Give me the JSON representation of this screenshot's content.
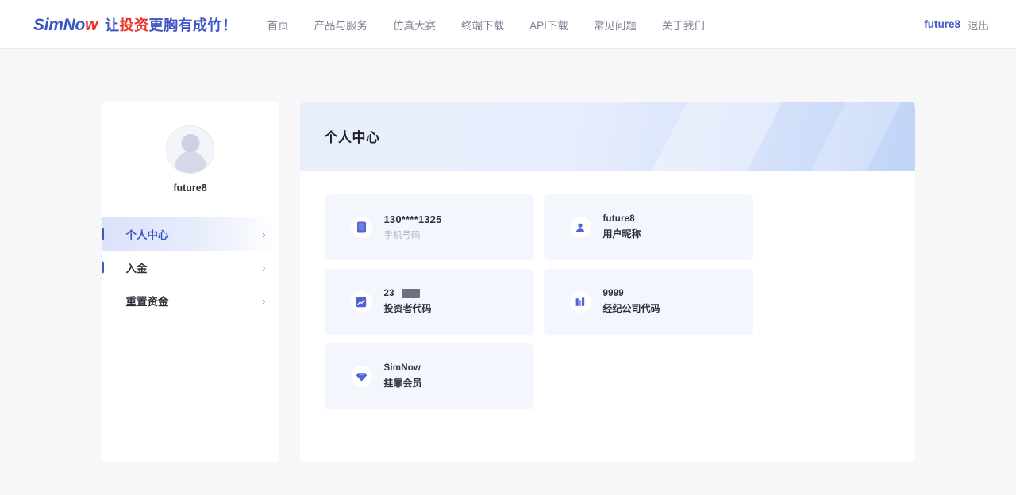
{
  "topbar": {
    "logo": {
      "part1": "SimNo",
      "part2": "w"
    },
    "slogan": {
      "p1": "让",
      "p2": "投资",
      "p3": "更胸有成竹！"
    },
    "nav": [
      {
        "label": "首页",
        "name": "nav-home"
      },
      {
        "label": "产品与服务",
        "name": "nav-products"
      },
      {
        "label": "仿真大赛",
        "name": "nav-contest"
      },
      {
        "label": "终端下载",
        "name": "nav-terminal-download"
      },
      {
        "label": "API下载",
        "name": "nav-api-download"
      },
      {
        "label": "常见问题",
        "name": "nav-faq"
      },
      {
        "label": "关于我们",
        "name": "nav-about"
      }
    ],
    "user": "future8",
    "logout": "退出"
  },
  "sidebar": {
    "avatar_name": "future8",
    "avatar_icon": "user-avatar-icon",
    "menu": [
      {
        "label": "个人中心",
        "chevron": "›",
        "active": true,
        "bar": true
      },
      {
        "label": "入金",
        "chevron": "›",
        "active": false,
        "bar": true
      },
      {
        "label": "重置资金",
        "chevron": "›",
        "active": false,
        "bar": false
      }
    ]
  },
  "main": {
    "title": "个人中心",
    "cards": [
      {
        "icon": "phone-icon",
        "value": "130****1325",
        "label": "手机号码",
        "redacted": false
      },
      {
        "icon": "user-icon",
        "value": "future8",
        "label": "用户昵称",
        "redacted": false
      },
      {
        "icon": "chart-icon",
        "value": "23",
        "label": "投资者代码",
        "redacted": true
      },
      {
        "icon": "building-icon",
        "value": "9999",
        "label": "经纪公司代码",
        "redacted": false
      },
      {
        "icon": "diamond-icon",
        "value": "SimNow",
        "label": "挂靠会员",
        "redacted": false
      }
    ]
  },
  "colors": {
    "brand_blue": "#4056c4",
    "brand_red": "#e8342a",
    "page_bg": "#f7f7f9",
    "card_bg": "#f3f6fd"
  }
}
